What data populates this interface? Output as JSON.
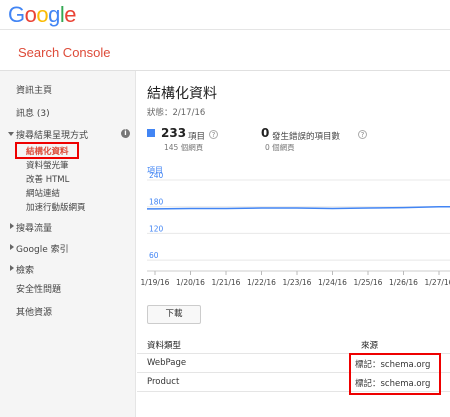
{
  "header": {
    "logo_letters": [
      {
        "char": "G",
        "color": "#4285F4"
      },
      {
        "char": "o",
        "color": "#EA4335"
      },
      {
        "char": "o",
        "color": "#FBBC05"
      },
      {
        "char": "g",
        "color": "#4285F4"
      },
      {
        "char": "l",
        "color": "#34A853"
      },
      {
        "char": "e",
        "color": "#EA4335"
      }
    ],
    "brand": "Search Console",
    "brand_color": "#DD4B39"
  },
  "sidebar": {
    "items": [
      {
        "label": "資訊主頁"
      },
      {
        "label": "訊息 (3)"
      },
      {
        "label": "搜尋結果呈現方式",
        "expanded": true,
        "info_icon": "i"
      },
      {
        "label": "結構化資料",
        "active": true
      },
      {
        "label": "資料螢光筆"
      },
      {
        "label": "改善 HTML"
      },
      {
        "label": "網站連結"
      },
      {
        "label": "加速行動版網頁"
      },
      {
        "label": "搜尋流量",
        "collapsed": true
      },
      {
        "label": "Google 索引",
        "collapsed": true
      },
      {
        "label": "檢索",
        "collapsed": true
      },
      {
        "label": "安全性問題"
      },
      {
        "label": "其他資源"
      }
    ]
  },
  "main": {
    "title": "結構化資料",
    "status": "狀態：2/17/16",
    "stats": [
      {
        "value": "233",
        "label": "項目",
        "sub": "145 個網頁",
        "help": "?"
      },
      {
        "value": "0",
        "label": "發生錯誤的項目數",
        "sub": "0 個網頁",
        "help": "?"
      }
    ],
    "series_label": "項目",
    "download_label": "下載",
    "table": {
      "headers": [
        "資料類型",
        "來源"
      ],
      "rows": [
        [
          "WebPage",
          "標記：schema.org"
        ],
        [
          "Product",
          "標記：schema.org"
        ]
      ]
    }
  },
  "chart_data": {
    "type": "line",
    "x": [
      "1/19/16",
      "1/20/16",
      "1/21/16",
      "1/22/16",
      "1/23/16",
      "1/24/16",
      "1/25/16",
      "1/26/16",
      "1/27/16"
    ],
    "series": [
      {
        "values": [
          175,
          176,
          176,
          177,
          177,
          176,
          177,
          178,
          180
        ],
        "color": "#4285F4"
      }
    ],
    "yticks": [
      60,
      120,
      180,
      240
    ],
    "ylim": [
      40,
      240
    ],
    "grid": true
  }
}
